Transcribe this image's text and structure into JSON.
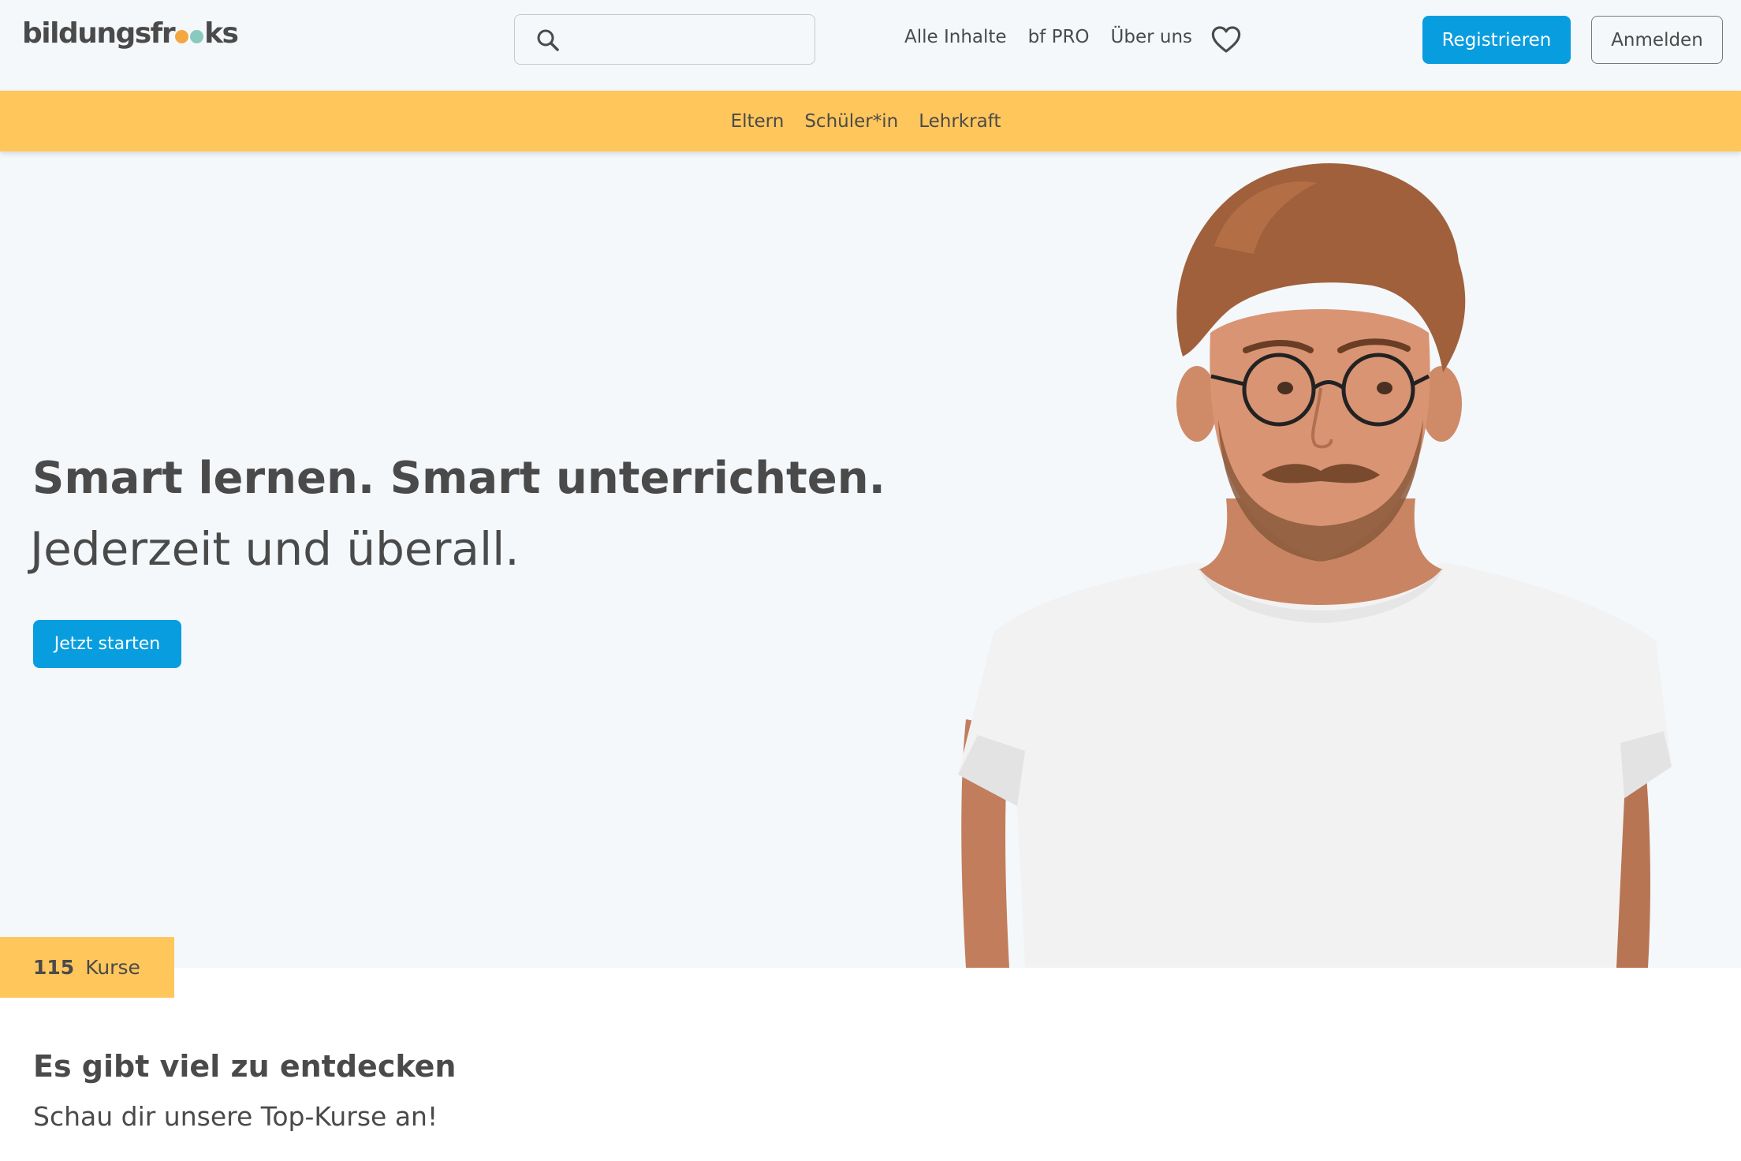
{
  "header": {
    "logo": {
      "prefix": "bildungsfr",
      "suffix": "ks",
      "dot_colors": [
        "#f4a740",
        "#89c9c0",
        "#d98c7a"
      ]
    },
    "search": {
      "placeholder": "",
      "value": "",
      "icon": "search-icon"
    },
    "nav": [
      {
        "label": "Alle Inhalte"
      },
      {
        "label": "bf PRO"
      },
      {
        "label": "Über uns"
      }
    ],
    "favorites_icon": "heart-icon",
    "register_label": "Registrieren",
    "login_label": "Anmelden"
  },
  "audience_nav": [
    {
      "label": "Eltern"
    },
    {
      "label": "Schüler*in"
    },
    {
      "label": "Lehrkraft"
    }
  ],
  "hero": {
    "headline": "Smart lernen. Smart unterrichten.",
    "subline": "Jederzeit und überall.",
    "cta_label": "Jetzt starten",
    "image": "man-with-glasses-photo"
  },
  "courses": {
    "count": "115",
    "label": "Kurse"
  },
  "discover": {
    "title": "Es gibt viel zu entdecken",
    "subtitle": "Schau dir unsere Top-Kurse an!"
  },
  "colors": {
    "primary": "#089ddf",
    "accent_yellow": "#ffc65c",
    "background": "#f4f8fb",
    "text": "#4a4a4a"
  }
}
